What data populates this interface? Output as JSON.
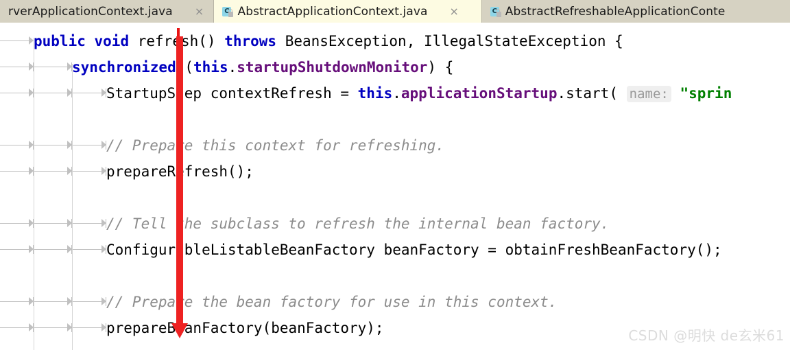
{
  "window": {
    "app": "IntelliJ IDEA editor",
    "background_color": "#ffffff"
  },
  "tabbar": {
    "background_color": "#d6d2c2",
    "active_color": "#fdfbe2",
    "tabs": [
      {
        "label": "rverApplicationContext.java",
        "icon": "java-class-icon",
        "active": false,
        "truncated_left": true,
        "close_label": "×"
      },
      {
        "label": "AbstractApplicationContext.java",
        "icon": "java-class-icon",
        "active": true,
        "truncated_left": false,
        "close_label": "×"
      },
      {
        "label": "AbstractRefreshableApplicationConte",
        "icon": "java-class-icon",
        "active": false,
        "truncated_left": false,
        "close_label": ""
      }
    ],
    "icon_letter": "C"
  },
  "editor": {
    "caret_color": "#e81313",
    "comment_color": "#8c8c8c",
    "keyword_color": "#0000c0",
    "field_color": "#660e7a",
    "string_color": "#008000",
    "hint_background": "#efefef",
    "lines": [
      {
        "id": "line-refresh-signature",
        "indent": 0,
        "tokens": [
          {
            "t": "public",
            "c": "kw"
          },
          {
            "t": " ",
            "c": "wsdot"
          },
          {
            "t": "void",
            "c": "kw"
          },
          {
            "t": " ",
            "c": "wsdot"
          },
          {
            "t": "refresh() ",
            "c": "plain"
          },
          {
            "t": "throws",
            "c": "kw"
          },
          {
            "t": " BeansException, IllegalStateException {",
            "c": "plain"
          }
        ]
      },
      {
        "id": "line-synchronized",
        "indent": 1,
        "tokens": [
          {
            "t": "synchronized",
            "c": "kw"
          },
          {
            "t": " (",
            "c": "plain"
          },
          {
            "t": "this",
            "c": "kw"
          },
          {
            "t": ".",
            "c": "plain"
          },
          {
            "t": "startupShutdownMonitor",
            "c": "field"
          },
          {
            "t": ") {",
            "c": "plain"
          }
        ]
      },
      {
        "id": "line-startup-step",
        "indent": 2,
        "tokens": [
          {
            "t": "StartupStep contextRefresh = ",
            "c": "plain"
          },
          {
            "t": "this",
            "c": "kw"
          },
          {
            "t": ".",
            "c": "plain"
          },
          {
            "t": "applicationStartup",
            "c": "field"
          },
          {
            "t": ".start( ",
            "c": "plain"
          },
          {
            "t": "name:",
            "c": "hint"
          },
          {
            "t": " ",
            "c": "plain"
          },
          {
            "t": "\"sprin",
            "c": "str"
          }
        ]
      },
      {
        "id": "line-blank-1",
        "indent": 2,
        "blank": true,
        "tokens": []
      },
      {
        "id": "line-comment-prepare-context",
        "indent": 2,
        "tokens": [
          {
            "t": "// Prepare this context for refreshing.",
            "c": "cmt"
          }
        ]
      },
      {
        "id": "line-prepare-refresh-call",
        "indent": 2,
        "tokens": [
          {
            "t": "prepareRefresh();",
            "c": "plain"
          }
        ]
      },
      {
        "id": "line-blank-2",
        "indent": 2,
        "blank": true,
        "tokens": []
      },
      {
        "id": "line-comment-tell-subclass",
        "indent": 2,
        "tokens": [
          {
            "t": "// Tell the subclass to refresh the internal bean factory.",
            "c": "cmt"
          }
        ]
      },
      {
        "id": "line-obtain-bean-factory",
        "indent": 2,
        "tokens": [
          {
            "t": "ConfigurableListableBeanFactory beanFactory = obtainFreshBeanFactory();",
            "c": "plain"
          }
        ]
      },
      {
        "id": "line-blank-3",
        "indent": 2,
        "blank": true,
        "tokens": []
      },
      {
        "id": "line-comment-prepare-bean-factory",
        "indent": 2,
        "tokens": [
          {
            "t": "// Prepare the bean factory for use in this context.",
            "c": "cmt"
          }
        ]
      },
      {
        "id": "line-prepare-bean-factory-call",
        "indent": 2,
        "tokens": [
          {
            "t": "prepareBeanFactory(beanFactory);",
            "c": "plain"
          }
        ]
      }
    ]
  },
  "annotation": {
    "name": "red-down-arrow",
    "color": "#ee2222"
  },
  "watermark": {
    "text": "CSDN @明快 de玄米61",
    "color": "#dcdcdc"
  }
}
